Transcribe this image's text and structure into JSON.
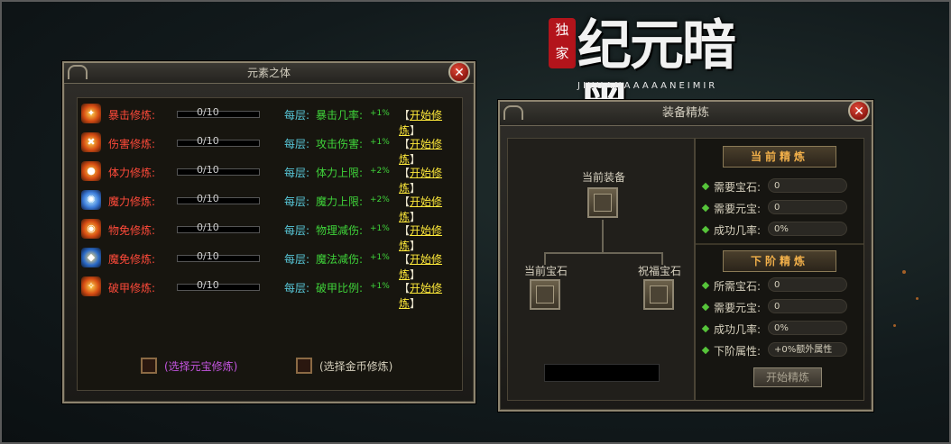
{
  "logo": {
    "seal_text": "独家",
    "title": "纪元暗黑",
    "subtitle": "JIYUANAAAAANEIMIR"
  },
  "element_panel": {
    "title": "元素之体",
    "close_icon": "close-icon",
    "layer_label": "每层:",
    "start_open": "【",
    "start_label": "开始修炼",
    "start_close": "】",
    "rows": [
      {
        "icon": "crit-icon",
        "name": "暴击修炼:",
        "progress": "0/10",
        "stat": "暴击几率:",
        "bonus": "+1%"
      },
      {
        "icon": "damage-icon",
        "name": "伤害修炼:",
        "progress": "0/10",
        "stat": "攻击伤害:",
        "bonus": "+1%"
      },
      {
        "icon": "stamina-icon",
        "name": "体力修炼:",
        "progress": "0/10",
        "stat": "体力上限:",
        "bonus": "+2%"
      },
      {
        "icon": "mana-icon",
        "name": "魔力修炼:",
        "progress": "0/10",
        "stat": "魔力上限:",
        "bonus": "+2%"
      },
      {
        "icon": "physical-immune-icon",
        "name": "物免修炼:",
        "progress": "0/10",
        "stat": "物理减伤:",
        "bonus": "+1%"
      },
      {
        "icon": "magic-immune-icon",
        "name": "魔免修炼:",
        "progress": "0/10",
        "stat": "魔法减伤:",
        "bonus": "+1%"
      },
      {
        "icon": "armor-break-icon",
        "name": "破甲修炼:",
        "progress": "0/10",
        "stat": "破甲比例:",
        "bonus": "+1%"
      }
    ],
    "option_gold_ingot": "(选择元宝修炼)",
    "option_gold_coin": "(选择金币修炼)"
  },
  "refine_panel": {
    "title": "装备精炼",
    "current_equipment": "当前装备",
    "current_gem": "当前宝石",
    "bless_gem": "祝福宝石",
    "current_section": "当前精炼",
    "current": {
      "gem_label": "需要宝石:",
      "gem_value": "0",
      "ingot_label": "需要元宝:",
      "ingot_value": "0",
      "rate_label": "成功几率:",
      "rate_value": "0%"
    },
    "next_section": "下阶精炼",
    "next": {
      "gem_label": "所需宝石:",
      "gem_value": "0",
      "ingot_label": "需要元宝:",
      "ingot_value": "0",
      "rate_label": "成功几率:",
      "rate_value": "0%",
      "attr_label": "下阶属性:",
      "attr_value": "+0%额外属性"
    },
    "start_button": "开始精炼"
  },
  "colors": {
    "stat_name": "#ff4a3a",
    "layer": "#58c7d8",
    "bonus": "#3fd43a",
    "link": "#ffea3a",
    "section_head": "#f2b04a"
  }
}
